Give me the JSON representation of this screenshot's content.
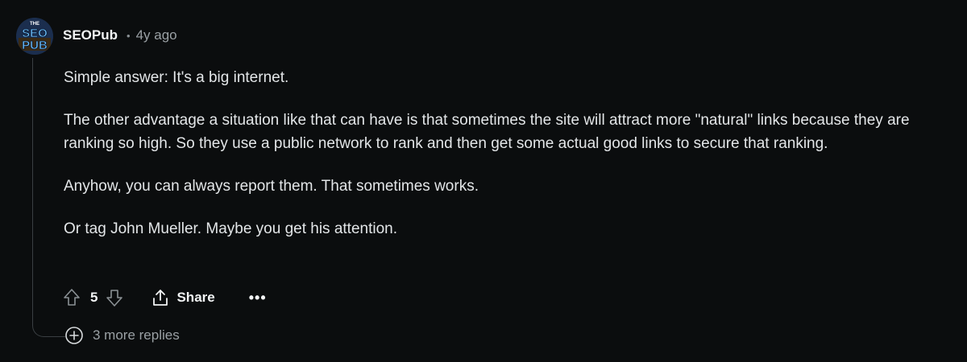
{
  "comment": {
    "author": "SEOPub",
    "separator": "•",
    "age": "4y ago",
    "avatar": {
      "line1": "THE",
      "line2": "SEO",
      "line3": "PUB"
    },
    "paragraphs": [
      "Simple answer: It's a big internet.",
      "The other advantage a situation like that can have is that sometimes the site will attract more \"natural\" links because they are ranking so high. So they use a public network to rank and then get some actual good links to secure that ranking.",
      "Anyhow, you can always report them. That sometimes works.",
      "Or tag John Mueller. Maybe you get his attention."
    ],
    "actions": {
      "upvote_icon": "arrow-up-icon",
      "vote_count": "5",
      "downvote_icon": "arrow-down-icon",
      "share_icon": "share-icon",
      "share_label": "Share",
      "more_label": "•••"
    },
    "more_replies": {
      "icon": "plus-circle-icon",
      "label": "3 more replies"
    }
  },
  "colors": {
    "background": "#0b0d0e",
    "text": "#e3e6e8",
    "muted": "#9aa0a4",
    "thread_line": "#3a3f42"
  }
}
